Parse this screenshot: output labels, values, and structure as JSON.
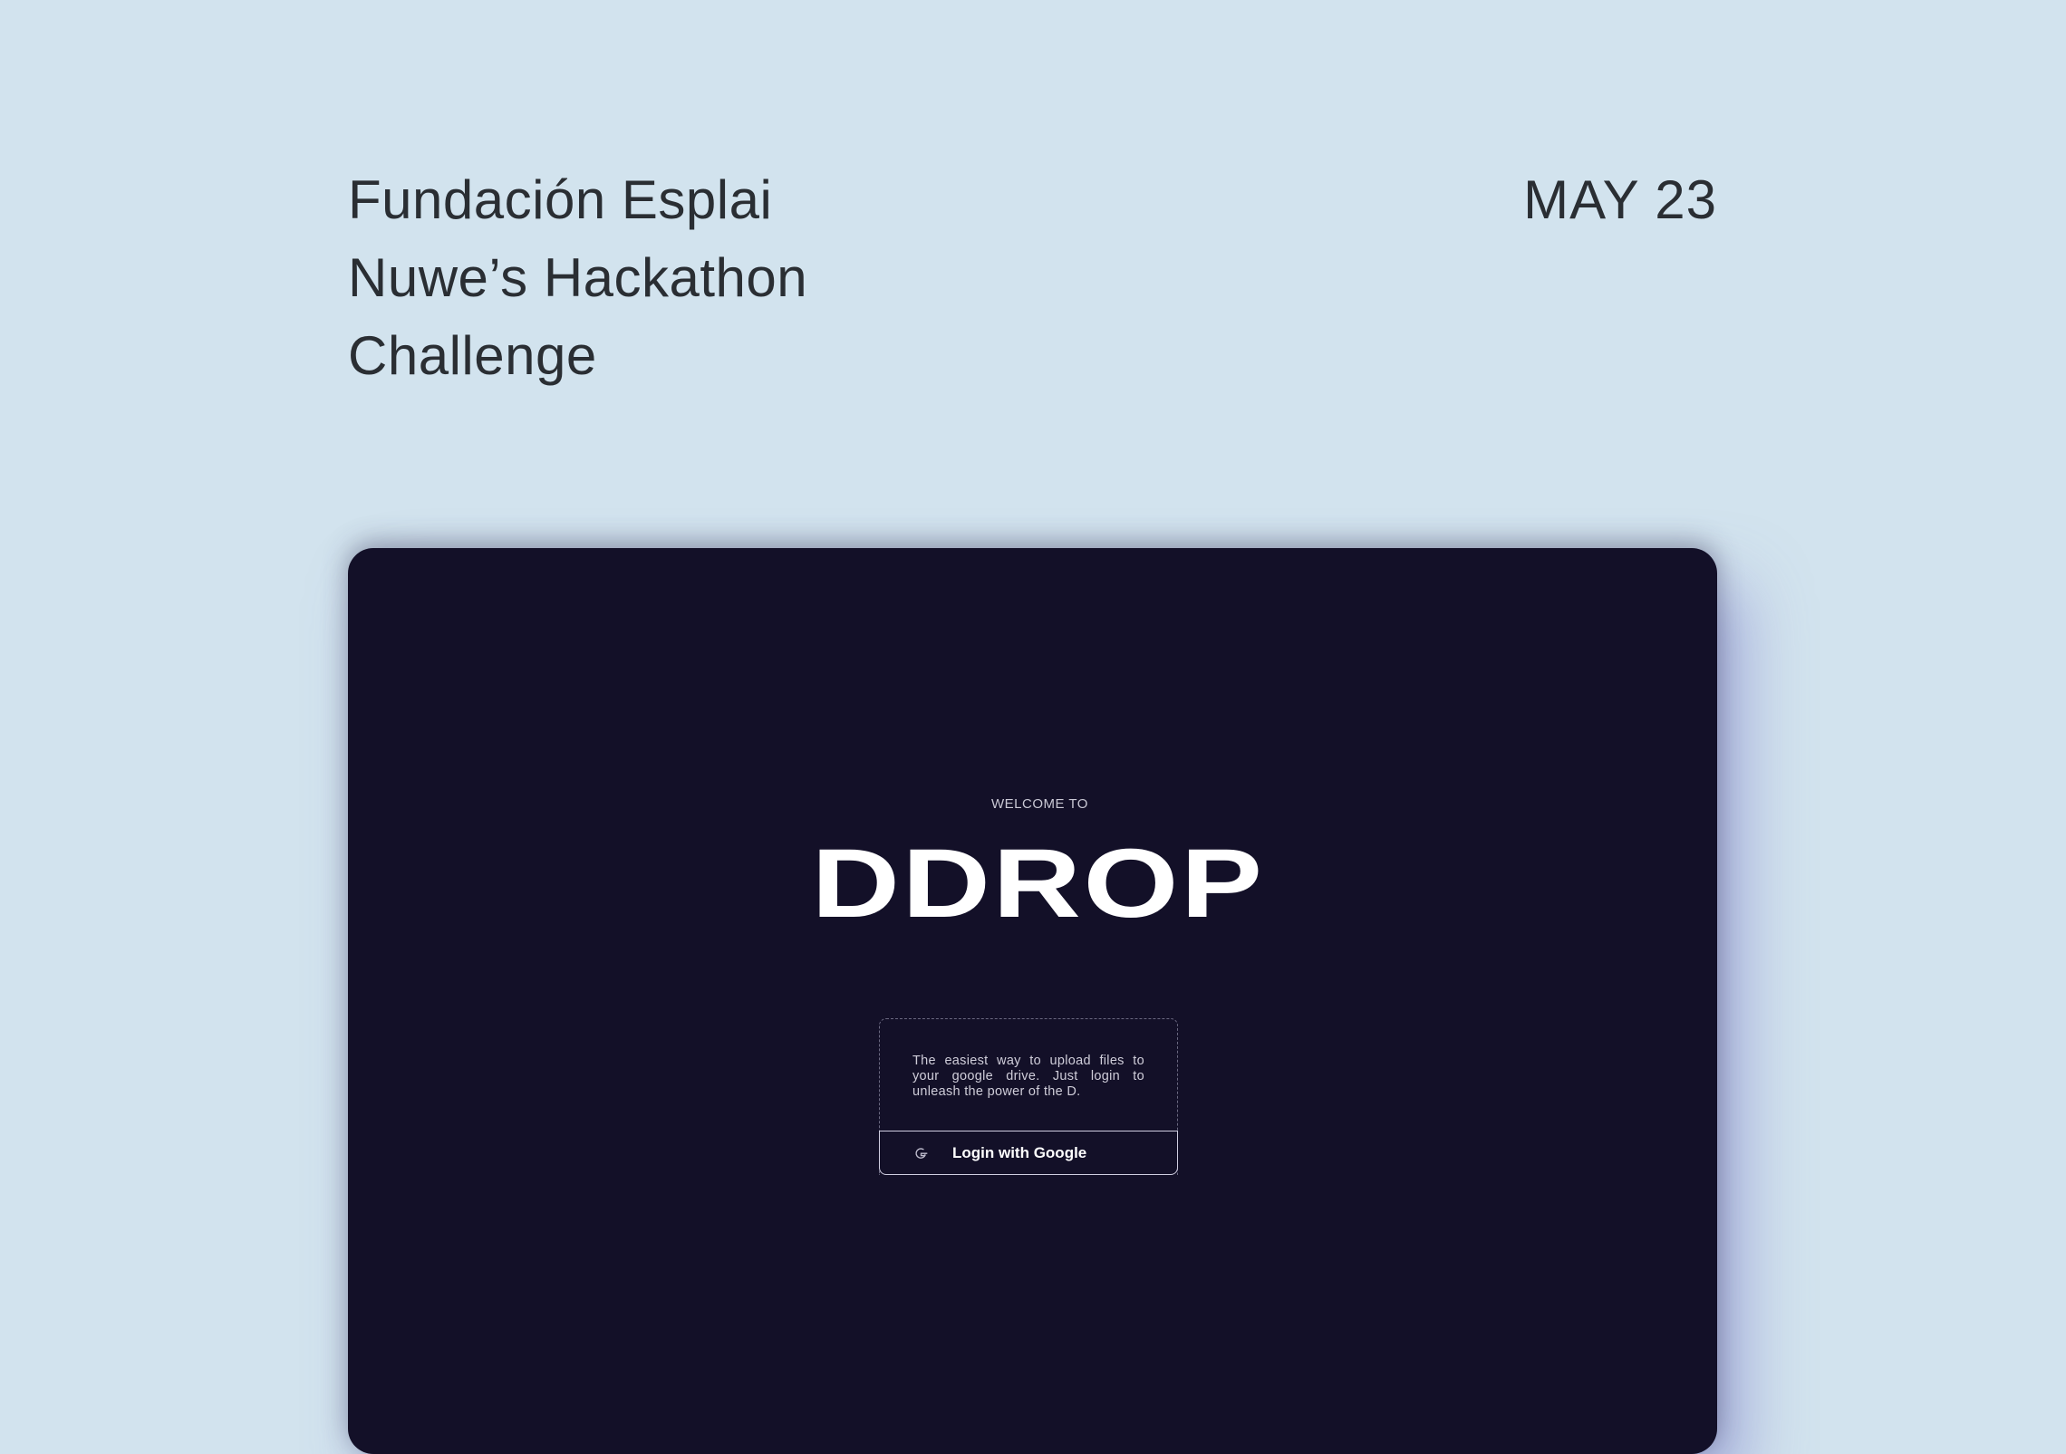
{
  "header": {
    "title_lines": [
      "Fundación Esplai",
      "Nuwe’s Hackathon",
      "Challenge"
    ],
    "date": "MAY 23"
  },
  "app": {
    "welcome": "WELCOME TO",
    "logo": "DDROP",
    "description": "The easiest way to upload files to your google drive. Just login to unleash the power of the D.",
    "login_label": "Login with Google",
    "login_icon": "google-icon",
    "background_color": "#131028"
  }
}
